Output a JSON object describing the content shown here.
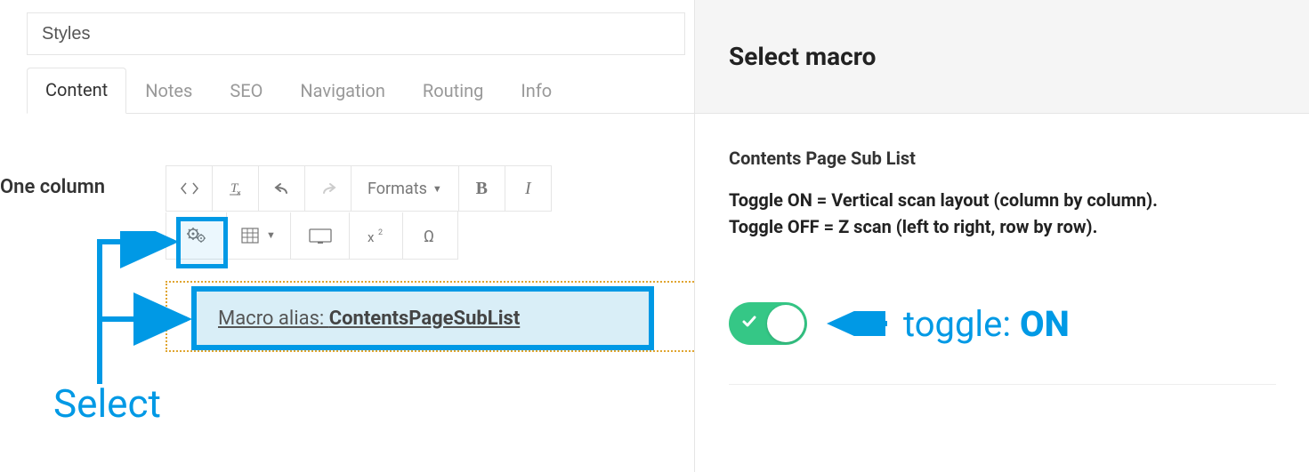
{
  "styles_placeholder": "Styles",
  "tabs": [
    {
      "label": "Content",
      "active": true
    },
    {
      "label": "Notes",
      "active": false
    },
    {
      "label": "SEO",
      "active": false
    },
    {
      "label": "Navigation",
      "active": false
    },
    {
      "label": "Routing",
      "active": false
    },
    {
      "label": "Info",
      "active": false
    }
  ],
  "section_label": "One column",
  "toolbar": {
    "formats_label": "Formats",
    "bold": "B",
    "italic": "I"
  },
  "macro_box": {
    "prefix": "Macro alias: ",
    "value": "ContentsPageSubList"
  },
  "annotation": {
    "select": "Select",
    "toggle_prefix": "toggle: ",
    "toggle_state": "ON"
  },
  "right": {
    "header": "Select macro",
    "macro_title": "Contents Page Sub List",
    "desc_line1": "Toggle ON = Vertical scan layout (column by column).",
    "desc_line2": "Toggle OFF = Z scan (left to right, row by row).",
    "toggle_on": true
  },
  "colors": {
    "accent": "#0099e5",
    "toggle_on": "#35c786"
  }
}
